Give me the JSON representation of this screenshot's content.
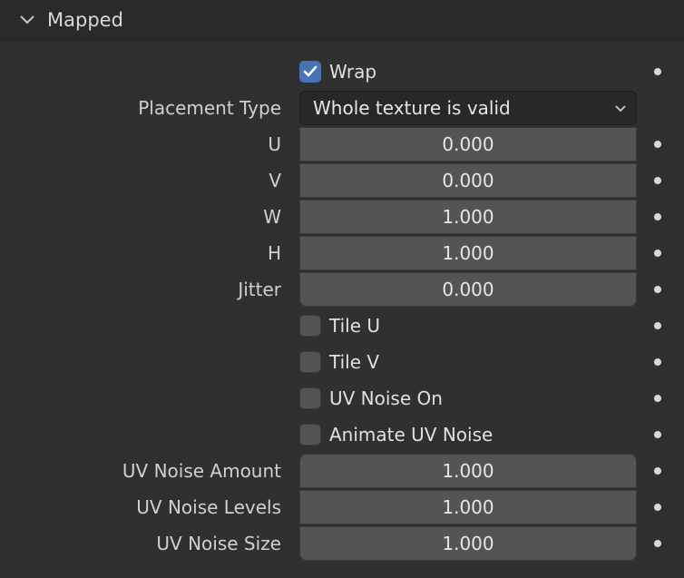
{
  "panel": {
    "title": "Mapped"
  },
  "wrap": {
    "label": "Wrap",
    "checked": true
  },
  "placement": {
    "label": "Placement Type",
    "value": "Whole texture is valid"
  },
  "fields": {
    "u": {
      "label": "U",
      "value": "0.000"
    },
    "v": {
      "label": "V",
      "value": "0.000"
    },
    "w": {
      "label": "W",
      "value": "1.000"
    },
    "h": {
      "label": "H",
      "value": "1.000"
    },
    "jitter": {
      "label": "Jitter",
      "value": "0.000"
    }
  },
  "toggles": {
    "tile_u": {
      "label": "Tile U",
      "checked": false
    },
    "tile_v": {
      "label": "Tile V",
      "checked": false
    },
    "uv_noise_on": {
      "label": "UV Noise On",
      "checked": false
    },
    "animate_uv_noise": {
      "label": "Animate UV Noise",
      "checked": false
    }
  },
  "noise": {
    "amount": {
      "label": "UV Noise Amount",
      "value": "1.000"
    },
    "levels": {
      "label": "UV Noise Levels",
      "value": "1.000"
    },
    "size": {
      "label": "UV Noise Size",
      "value": "1.000"
    }
  },
  "icons": {
    "header": "chevron-down-icon",
    "dropdown": "chevron-down-icon",
    "check": "checkmark-icon",
    "keyframe": "keyframe-dot-icon"
  },
  "colors": {
    "background": "#303030",
    "header": "#2a2a2a",
    "field": "#545454",
    "dropdown": "#282828",
    "accent": "#4772b3"
  }
}
